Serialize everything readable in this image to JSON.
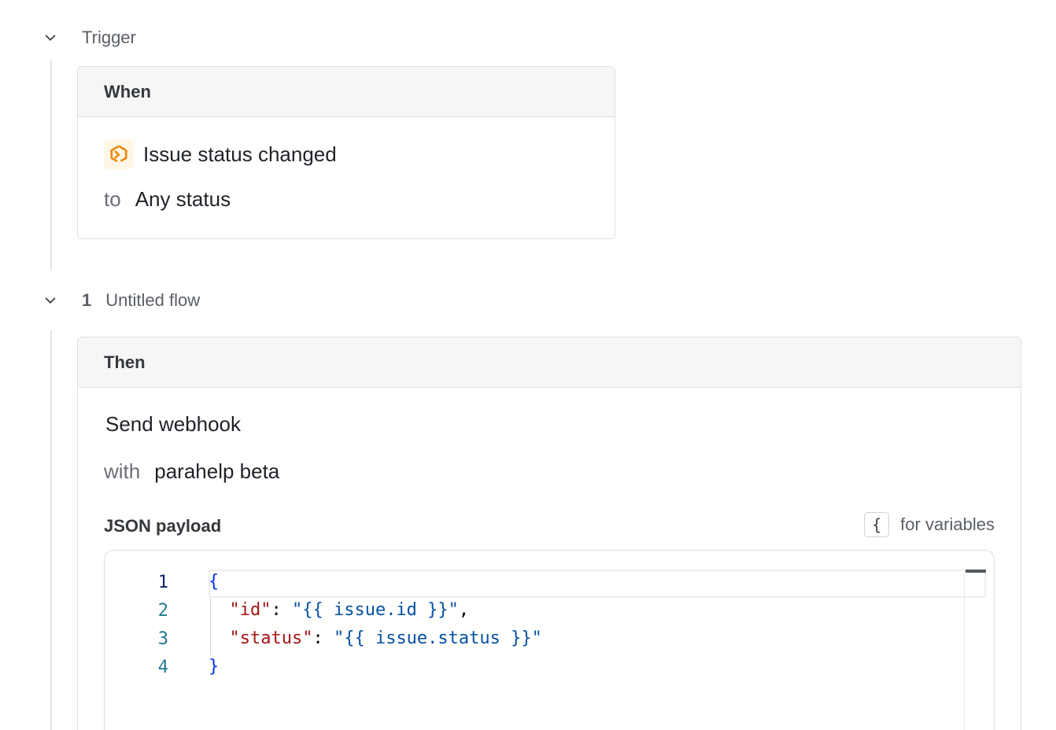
{
  "trigger": {
    "section_title": "Trigger",
    "card_header": "When",
    "event_icon": "issue-status-icon",
    "event_label": "Issue status changed",
    "condition_prefix": "to",
    "condition_value": "Any status"
  },
  "flow": {
    "number": "1",
    "title": "Untitled flow",
    "card_header": "Then",
    "action_label": "Send webhook",
    "with_prefix": "with",
    "with_value": "parahelp beta",
    "payload_label": "JSON payload",
    "variables_key": "{",
    "variables_hint": "for variables",
    "editor": {
      "line_numbers": [
        "1",
        "2",
        "3",
        "4"
      ],
      "lines": [
        [
          {
            "t": "brace",
            "v": "{"
          }
        ],
        [
          {
            "t": "punct",
            "v": "  "
          },
          {
            "t": "key",
            "v": "\"id\""
          },
          {
            "t": "punct",
            "v": ": "
          },
          {
            "t": "str",
            "v": "\"{{ issue.id }}\""
          },
          {
            "t": "punct",
            "v": ","
          }
        ],
        [
          {
            "t": "punct",
            "v": "  "
          },
          {
            "t": "key",
            "v": "\"status\""
          },
          {
            "t": "punct",
            "v": ": "
          },
          {
            "t": "str",
            "v": "\"{{ issue.status }}\""
          }
        ],
        [
          {
            "t": "brace",
            "v": "}"
          }
        ]
      ]
    }
  },
  "colors": {
    "trigger_icon": "#e8890c",
    "json_key": "#a31515",
    "json_string": "#0451a5",
    "json_brace": "#0431fa",
    "line_number": "#237893"
  }
}
